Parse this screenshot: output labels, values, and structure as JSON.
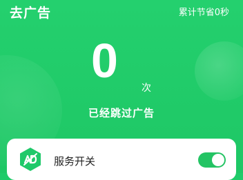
{
  "header": {
    "title": "去广告",
    "saved_time": "累计节省0秒"
  },
  "stats": {
    "count": "0",
    "unit": "次",
    "label": "已经跳过广告"
  },
  "service": {
    "label": "服务开关",
    "toggle_on": true
  },
  "colors": {
    "brand_green": "#1fcb69",
    "toggle_green": "#24c464",
    "icon_green": "#1fc96a",
    "card_bg": "#ffffff"
  },
  "icons": {
    "service": "ad-block-hexagon-icon"
  }
}
